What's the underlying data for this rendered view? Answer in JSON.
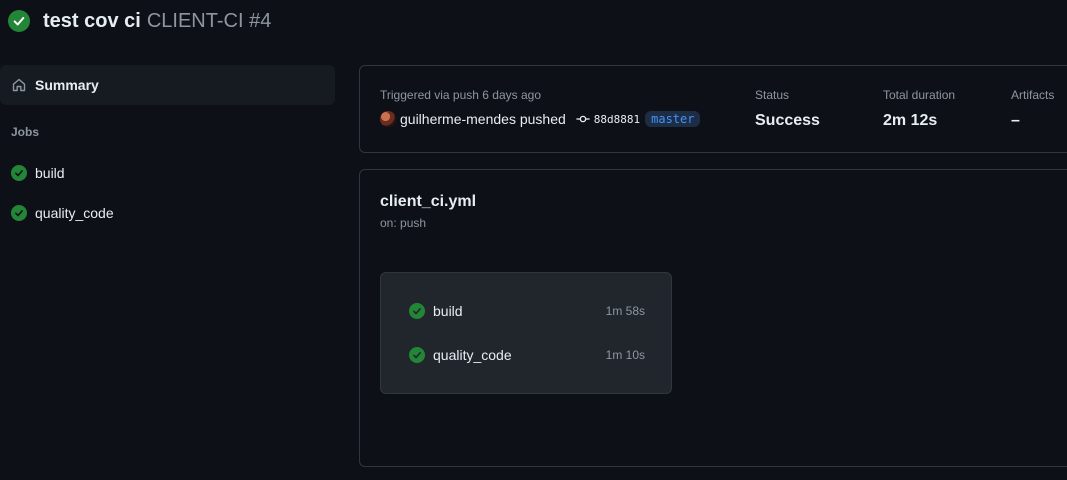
{
  "header": {
    "run_name": "test cov ci",
    "workflow_run": "CLIENT-CI #4"
  },
  "sidebar": {
    "summary_label": "Summary",
    "jobs_heading": "Jobs",
    "jobs": [
      {
        "label": "build",
        "status": "success"
      },
      {
        "label": "quality_code",
        "status": "success"
      }
    ]
  },
  "summary_panel": {
    "triggered_text": "Triggered via push 6 days ago",
    "actor_text": "guilherme-mendes pushed",
    "commit_sha": "88d8881",
    "branch": "master",
    "status_label": "Status",
    "status_value": "Success",
    "duration_label": "Total duration",
    "duration_value": "2m 12s",
    "artifacts_label": "Artifacts",
    "artifacts_value": "–"
  },
  "graph_panel": {
    "workflow_file": "client_ci.yml",
    "trigger": "on: push",
    "jobs": [
      {
        "name": "build",
        "duration": "1m 58s",
        "status": "success"
      },
      {
        "name": "quality_code",
        "duration": "1m 10s",
        "status": "success"
      }
    ]
  },
  "colors": {
    "background": "#0d1117",
    "success": "#238636",
    "muted_text": "#8d96a0",
    "branch_text": "#4493f8"
  },
  "icons": [
    "check-circle-icon",
    "home-icon",
    "commit-icon",
    "avatar"
  ]
}
